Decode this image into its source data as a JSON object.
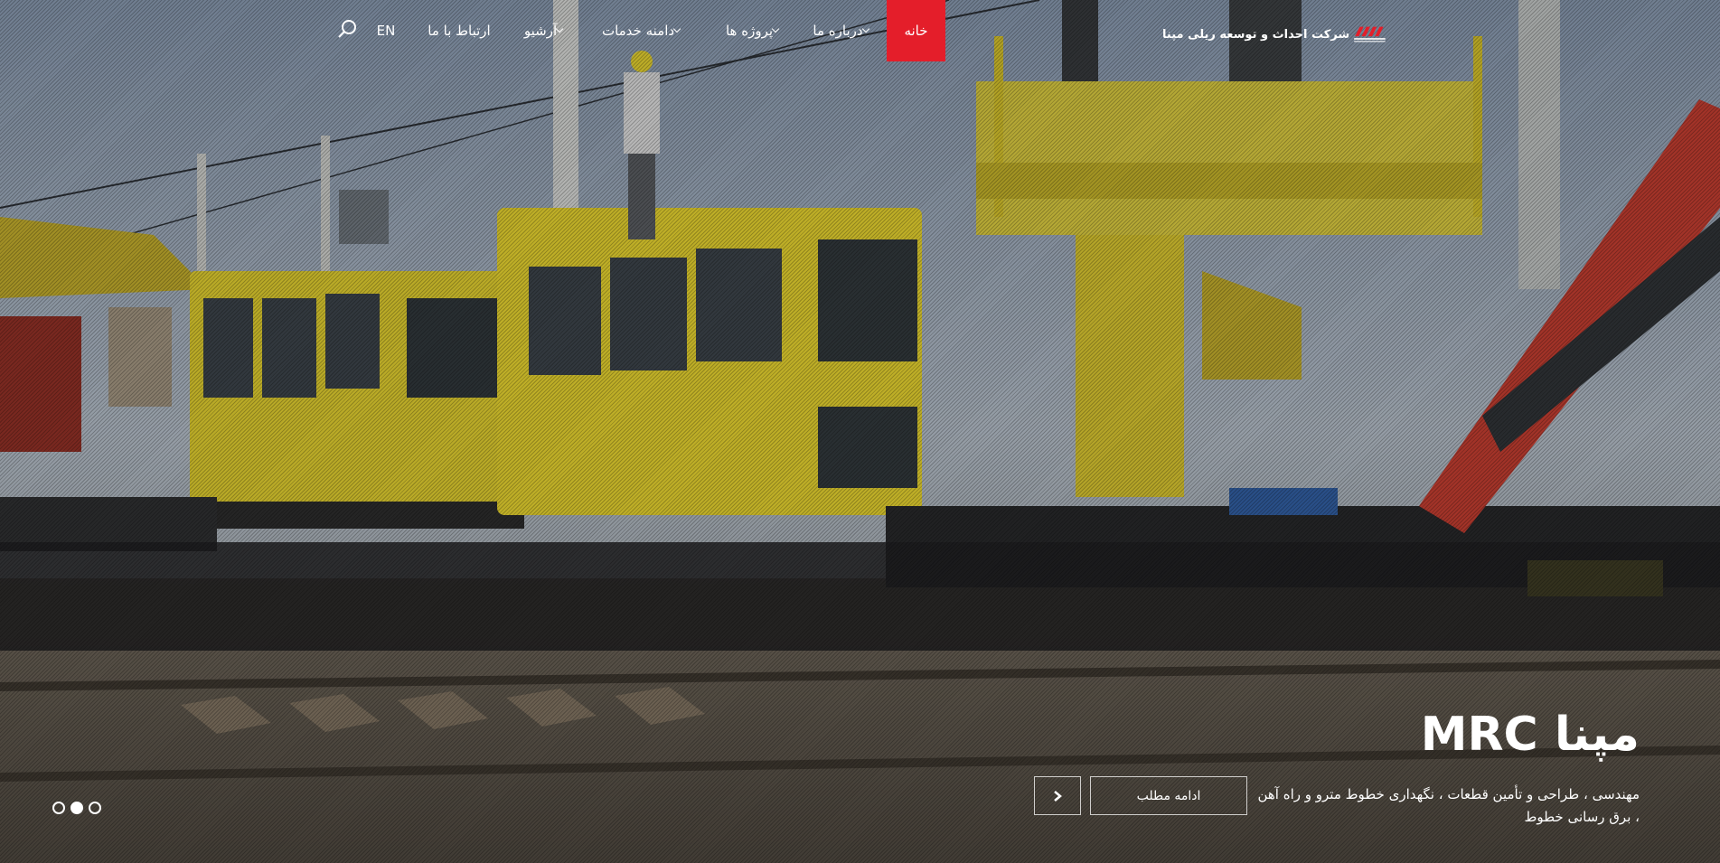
{
  "brand": {
    "name": "شرکت احداث و توسعه ریلی مپنا",
    "logo_word": "مپنا",
    "color": "#e41e2a"
  },
  "nav": {
    "items": [
      {
        "label": "خانه",
        "active": true
      },
      {
        "label": "درباره ما",
        "dropdown": true
      },
      {
        "label": "پروژه ها",
        "dropdown": true
      },
      {
        "label": "دامنه خدمات",
        "dropdown": true
      },
      {
        "label": "آرشیو",
        "dropdown": true
      },
      {
        "label": "ارتباط با ما",
        "dropdown": false
      }
    ],
    "lang": "EN",
    "search_icon": "search-icon"
  },
  "slide": {
    "title": "مپنا MRC",
    "description": "مهندسی ، طراحی و تأمین قطعات ، نگهداری خطوط مترو و راه آهن ، برق رسانی خطوط",
    "read_more": "ادامه مطلب",
    "next_icon": "chevron-right-icon",
    "count": 3,
    "active_index": 1
  }
}
